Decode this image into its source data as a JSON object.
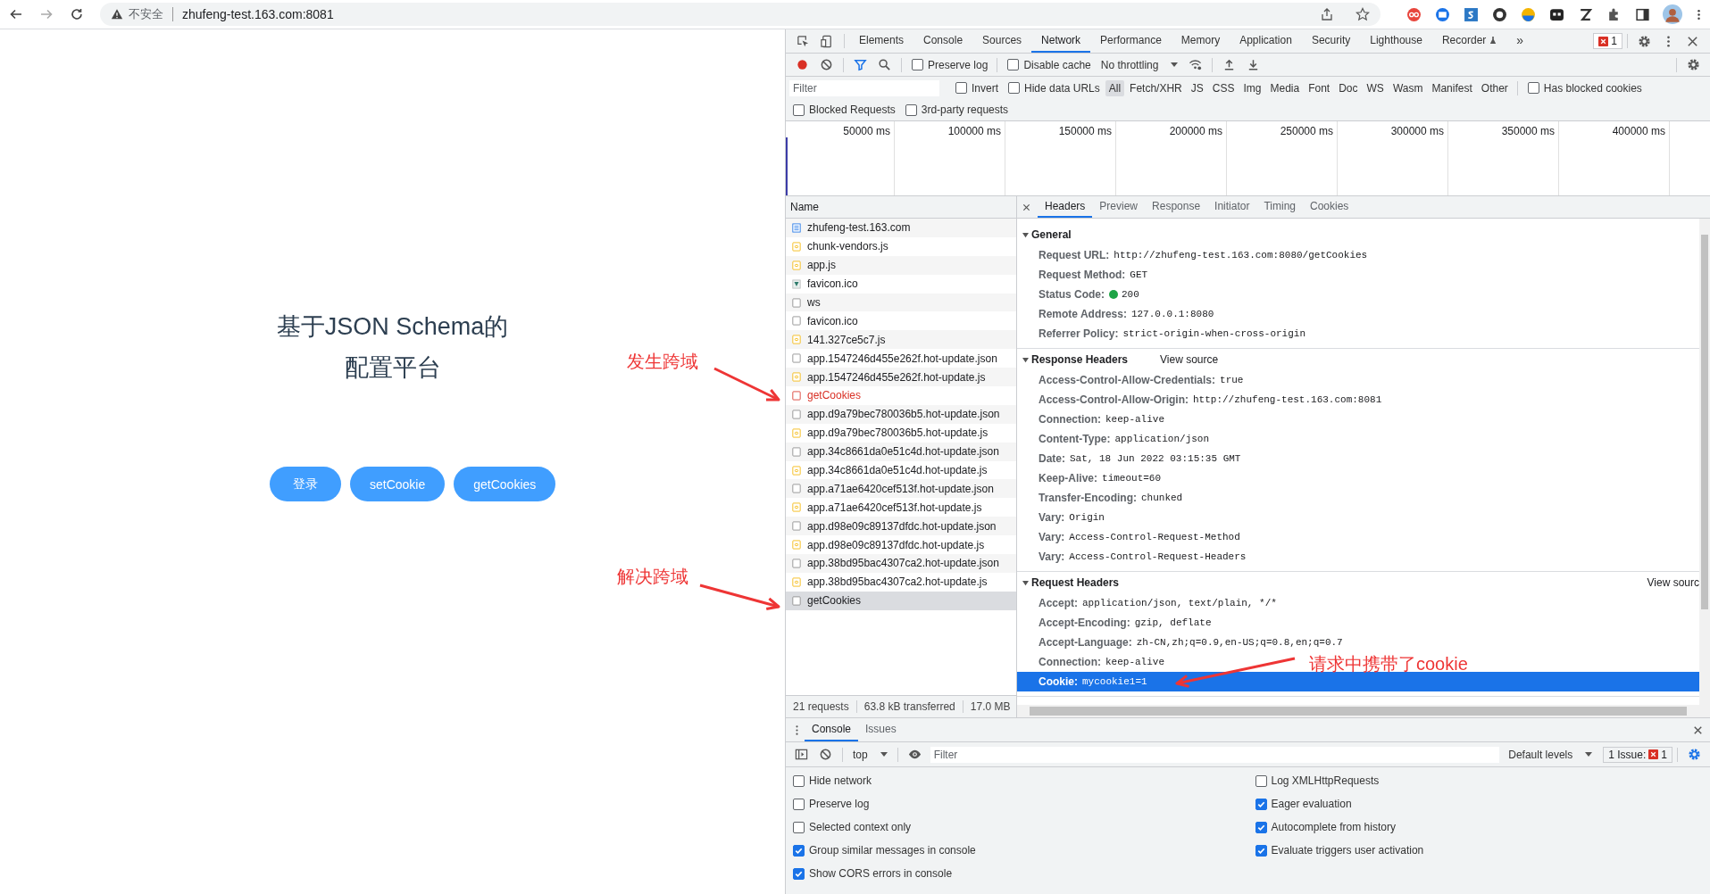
{
  "browser": {
    "security_label": "不安全",
    "url": "zhufeng-test.163.com:8081"
  },
  "page": {
    "title_lines": [
      "基于JSON Schema的",
      "配置平台"
    ],
    "buttons": [
      "登录",
      "setCookie",
      "getCookies"
    ]
  },
  "annotations": [
    {
      "text": "发生跨域"
    },
    {
      "text": "解决跨域"
    },
    {
      "text": "请求中携带了cookie"
    }
  ],
  "devtools": {
    "tabs": [
      {
        "label": "Elements",
        "selected": false
      },
      {
        "label": "Console",
        "selected": false
      },
      {
        "label": "Sources",
        "selected": false
      },
      {
        "label": "Network",
        "selected": true
      },
      {
        "label": "Performance",
        "selected": false
      },
      {
        "label": "Memory",
        "selected": false
      },
      {
        "label": "Application",
        "selected": false
      },
      {
        "label": "Security",
        "selected": false
      },
      {
        "label": "Lighthouse",
        "selected": false
      },
      {
        "label": "Recorder",
        "selected": false
      }
    ],
    "more_tabs": "»",
    "error_count": "1",
    "toolbar": {
      "recording": true,
      "preserve_log": {
        "label": "Preserve log",
        "checked": false
      },
      "disable_cache": {
        "label": "Disable cache",
        "checked": false
      },
      "throttling": "No throttling"
    },
    "filter": {
      "placeholder": "Filter",
      "invert": {
        "label": "Invert",
        "checked": false
      },
      "hide_data_urls": {
        "label": "Hide data URLs",
        "checked": false
      },
      "types": [
        {
          "label": "All",
          "selected": true
        },
        {
          "label": "Fetch/XHR",
          "selected": false
        },
        {
          "label": "JS",
          "selected": false
        },
        {
          "label": "CSS",
          "selected": false
        },
        {
          "label": "Img",
          "selected": false
        },
        {
          "label": "Media",
          "selected": false
        },
        {
          "label": "Font",
          "selected": false
        },
        {
          "label": "Doc",
          "selected": false
        },
        {
          "label": "WS",
          "selected": false
        },
        {
          "label": "Wasm",
          "selected": false
        },
        {
          "label": "Manifest",
          "selected": false
        },
        {
          "label": "Other",
          "selected": false
        }
      ],
      "has_blocked_cookies": {
        "label": "Has blocked cookies",
        "checked": false
      },
      "blocked_requests": {
        "label": "Blocked Requests",
        "checked": false
      },
      "third_party": {
        "label": "3rd-party requests",
        "checked": false
      }
    },
    "timeline_ticks": [
      "50000 ms",
      "100000 ms",
      "150000 ms",
      "200000 ms",
      "250000 ms",
      "300000 ms",
      "350000 ms",
      "400000 ms"
    ],
    "requests": {
      "header": "Name",
      "items": [
        {
          "name": "zhufeng-test.163.com",
          "kind": "doc",
          "failed": false,
          "selected": false
        },
        {
          "name": "chunk-vendors.js",
          "kind": "script",
          "failed": false,
          "selected": false
        },
        {
          "name": "app.js",
          "kind": "script",
          "failed": false,
          "selected": false
        },
        {
          "name": "favicon.ico",
          "kind": "image",
          "failed": false,
          "selected": false
        },
        {
          "name": "ws",
          "kind": "other",
          "failed": false,
          "selected": false
        },
        {
          "name": "favicon.ico",
          "kind": "other",
          "failed": false,
          "selected": false
        },
        {
          "name": "141.327ce5c7.js",
          "kind": "script",
          "failed": false,
          "selected": false
        },
        {
          "name": "app.1547246d455e262f.hot-update.json",
          "kind": "other",
          "failed": false,
          "selected": false
        },
        {
          "name": "app.1547246d455e262f.hot-update.js",
          "kind": "script",
          "failed": false,
          "selected": false
        },
        {
          "name": "getCookies",
          "kind": "other",
          "failed": true,
          "selected": false
        },
        {
          "name": "app.d9a79bec780036b5.hot-update.json",
          "kind": "other",
          "failed": false,
          "selected": false
        },
        {
          "name": "app.d9a79bec780036b5.hot-update.js",
          "kind": "script",
          "failed": false,
          "selected": false
        },
        {
          "name": "app.34c8661da0e51c4d.hot-update.json",
          "kind": "other",
          "failed": false,
          "selected": false
        },
        {
          "name": "app.34c8661da0e51c4d.hot-update.js",
          "kind": "script",
          "failed": false,
          "selected": false
        },
        {
          "name": "app.a71ae6420cef513f.hot-update.json",
          "kind": "other",
          "failed": false,
          "selected": false
        },
        {
          "name": "app.a71ae6420cef513f.hot-update.js",
          "kind": "script",
          "failed": false,
          "selected": false
        },
        {
          "name": "app.d98e09c89137dfdc.hot-update.json",
          "kind": "other",
          "failed": false,
          "selected": false
        },
        {
          "name": "app.d98e09c89137dfdc.hot-update.js",
          "kind": "script",
          "failed": false,
          "selected": false
        },
        {
          "name": "app.38bd95bac4307ca2.hot-update.json",
          "kind": "other",
          "failed": false,
          "selected": false
        },
        {
          "name": "app.38bd95bac4307ca2.hot-update.js",
          "kind": "script",
          "failed": false,
          "selected": false
        },
        {
          "name": "getCookies",
          "kind": "other",
          "failed": false,
          "selected": true
        }
      ]
    },
    "summary": [
      "21 requests",
      "63.8 kB transferred",
      "17.0 MB"
    ],
    "detail": {
      "tabs": [
        {
          "label": "Headers",
          "selected": true
        },
        {
          "label": "Preview",
          "selected": false
        },
        {
          "label": "Response",
          "selected": false
        },
        {
          "label": "Initiator",
          "selected": false
        },
        {
          "label": "Timing",
          "selected": false
        },
        {
          "label": "Cookies",
          "selected": false
        }
      ],
      "sections": [
        {
          "title": "General",
          "expanded": true,
          "rows": [
            {
              "name": "Request URL:",
              "value": "http://zhufeng-test.163.com:8080/getCookies",
              "kind": "plain",
              "selected": false
            },
            {
              "name": "Request Method:",
              "value": "GET",
              "kind": "plain",
              "selected": false
            },
            {
              "name": "Status Code:",
              "value": "200",
              "kind": "status",
              "selected": false
            },
            {
              "name": "Remote Address:",
              "value": "127.0.0.1:8080",
              "kind": "plain",
              "selected": false
            },
            {
              "name": "Referrer Policy:",
              "value": "strict-origin-when-cross-origin",
              "kind": "plain",
              "selected": false
            }
          ]
        },
        {
          "title": "Response Headers",
          "expanded": true,
          "view_source": "View source",
          "rows": [
            {
              "name": "Access-Control-Allow-Credentials:",
              "value": "true",
              "kind": "plain",
              "selected": false
            },
            {
              "name": "Access-Control-Allow-Origin:",
              "value": "http://zhufeng-test.163.com:8081",
              "kind": "plain",
              "selected": false
            },
            {
              "name": "Connection:",
              "value": "keep-alive",
              "kind": "plain",
              "selected": false
            },
            {
              "name": "Content-Type:",
              "value": "application/json",
              "kind": "plain",
              "selected": false
            },
            {
              "name": "Date:",
              "value": "Sat, 18 Jun 2022 03:15:35 GMT",
              "kind": "plain",
              "selected": false
            },
            {
              "name": "Keep-Alive:",
              "value": "timeout=60",
              "kind": "plain",
              "selected": false
            },
            {
              "name": "Transfer-Encoding:",
              "value": "chunked",
              "kind": "plain",
              "selected": false
            },
            {
              "name": "Vary:",
              "value": "Origin",
              "kind": "plain",
              "selected": false
            },
            {
              "name": "Vary:",
              "value": "Access-Control-Request-Method",
              "kind": "plain",
              "selected": false
            },
            {
              "name": "Vary:",
              "value": "Access-Control-Request-Headers",
              "kind": "plain",
              "selected": false
            }
          ]
        },
        {
          "title": "Request Headers",
          "expanded": true,
          "view_source": "View sourc",
          "rows": [
            {
              "name": "Accept:",
              "value": "application/json, text/plain, */*",
              "kind": "plain",
              "selected": false
            },
            {
              "name": "Accept-Encoding:",
              "value": "gzip, deflate",
              "kind": "plain",
              "selected": false
            },
            {
              "name": "Accept-Language:",
              "value": "zh-CN,zh;q=0.9,en-US;q=0.8,en;q=0.7",
              "kind": "plain",
              "selected": false
            },
            {
              "name": "Connection:",
              "value": "keep-alive",
              "kind": "plain",
              "selected": false
            },
            {
              "name": "Cookie:",
              "value": "mycookie1=1",
              "kind": "plain",
              "selected": true
            }
          ]
        }
      ]
    }
  },
  "console": {
    "tabs": [
      {
        "label": "Console",
        "selected": true
      },
      {
        "label": "Issues",
        "selected": false
      }
    ],
    "context": "top",
    "filter_placeholder": "Filter",
    "levels": "Default levels",
    "issues_label": "1 Issue:",
    "issue_count": "1",
    "settings_left": [
      {
        "label": "Hide network",
        "checked": false
      },
      {
        "label": "Preserve log",
        "checked": false
      },
      {
        "label": "Selected context only",
        "checked": false
      },
      {
        "label": "Group similar messages in console",
        "checked": true
      },
      {
        "label": "Show CORS errors in console",
        "checked": true
      }
    ],
    "settings_right": [
      {
        "label": "Log XMLHttpRequests",
        "checked": false
      },
      {
        "label": "Eager evaluation",
        "checked": true
      },
      {
        "label": "Autocomplete from history",
        "checked": true
      },
      {
        "label": "Evaluate triggers user activation",
        "checked": true
      }
    ]
  }
}
